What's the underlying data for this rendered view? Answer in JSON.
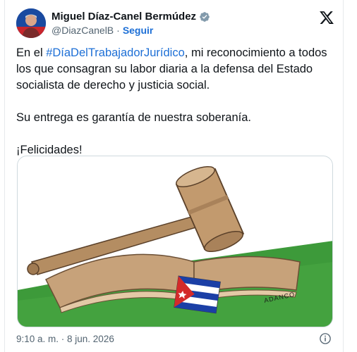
{
  "author": {
    "name": "Miguel Díaz-Canel Bermúdez",
    "handle": "@DiazCanelB",
    "separator": "·",
    "follow_label": "Seguir"
  },
  "icons": {
    "verified": "verified-badge-icon",
    "x_logo": "x-logo-icon",
    "info": "info-icon"
  },
  "tweet": {
    "line1_prefix": "En el ",
    "hashtag": "#DíaDelTrabajadorJurídico",
    "line1_suffix": ", mi reconocimiento a todos los que consagran su labor diaria a la defensa del Estado socialista de derecho y justicia social.",
    "paragraph2": "Su entrega es garantía de nuestra soberanía.",
    "paragraph3": "¡Felicidades!"
  },
  "media": {
    "signature": "ADANCO"
  },
  "footer": {
    "timestamp": "9:10 a. m. · 8 jun. 2026"
  },
  "colors": {
    "link": "#1d6fd6",
    "text": "#0f1419",
    "muted": "#536471",
    "verified": "#829aab"
  }
}
